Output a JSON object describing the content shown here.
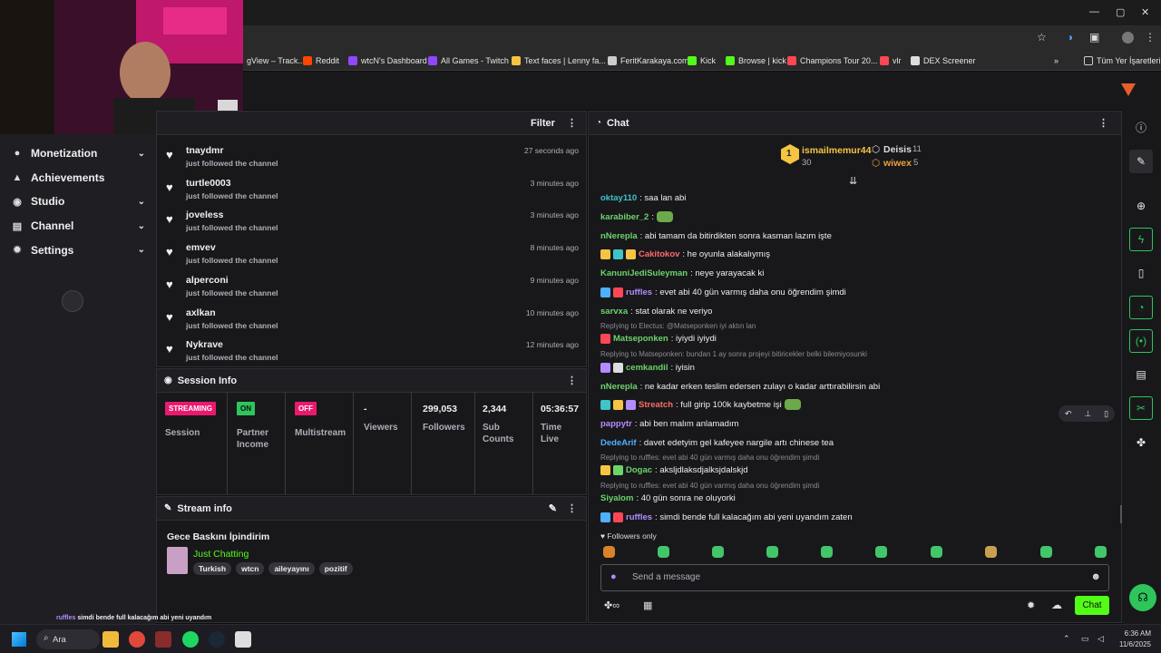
{
  "browser": {
    "bookmarks": [
      {
        "label": "gView – Track...",
        "color": "#3a7bd5"
      },
      {
        "label": "Reddit",
        "color": "#ff4500"
      },
      {
        "label": "wtcN's Dashboard",
        "color": "#9146ff"
      },
      {
        "label": "All Games - Twitch",
        "color": "#9146ff"
      },
      {
        "label": "Text faces | Lenny fa...",
        "color": "#f5c542"
      },
      {
        "label": "FeritKarakaya.com",
        "color": "#cccccc"
      },
      {
        "label": "Kick",
        "color": "#53fc18"
      },
      {
        "label": "Browse | kick",
        "color": "#53fc18"
      },
      {
        "label": "Champions Tour 20...",
        "color": "#ff4655"
      },
      {
        "label": "vlr",
        "color": "#ff4655"
      },
      {
        "label": "DEX Screener",
        "color": "#dddddd"
      }
    ],
    "all_bookmarks_label": "Tüm Yer İşaretleri",
    "chevron": "»"
  },
  "nav": {
    "items": [
      {
        "label": "Monetization",
        "icon": "dollar-icon",
        "glyph": "●",
        "chev": "⌄"
      },
      {
        "label": "Achievements",
        "icon": "trophy-icon",
        "glyph": "▲",
        "chev": ""
      },
      {
        "label": "Studio",
        "icon": "studio-icon",
        "glyph": "◉",
        "chev": "⌄"
      },
      {
        "label": "Channel",
        "icon": "channel-icon",
        "glyph": "▤",
        "chev": "⌄"
      },
      {
        "label": "Settings",
        "icon": "gear-icon",
        "glyph": "✹",
        "chev": "⌄"
      }
    ]
  },
  "activity": {
    "filter_label": "Filter",
    "items": [
      {
        "user": "tnaydmr",
        "action": "just followed the channel",
        "ago": "27 seconds ago"
      },
      {
        "user": "turtle0003",
        "action": "just followed the channel",
        "ago": "3 minutes ago"
      },
      {
        "user": "joveless",
        "action": "just followed the channel",
        "ago": "3 minutes ago"
      },
      {
        "user": "emvev",
        "action": "just followed the channel",
        "ago": "8 minutes ago"
      },
      {
        "user": "alperconi",
        "action": "just followed the channel",
        "ago": "9 minutes ago"
      },
      {
        "user": "axlkan",
        "action": "just followed the channel",
        "ago": "10 minutes ago"
      },
      {
        "user": "Nykrave",
        "action": "just followed the channel",
        "ago": "12 minutes ago"
      }
    ]
  },
  "session": {
    "title": "Session Info",
    "streaming_badge": "STREAMING",
    "session_label": "Session",
    "partner_badge": "ON",
    "partner_label": "Partner Income",
    "multistream_badge": "OFF",
    "multistream_label": "Multistream",
    "viewers_value": "-",
    "viewers_label": "Viewers",
    "followers_value": "299,053",
    "followers_label": "Followers",
    "subs_value": "2,344",
    "subs_label": "Sub Counts",
    "time_value": "05:36:57",
    "time_label": "Time Live"
  },
  "stream_info": {
    "title": "Stream info",
    "stream_title": "Gece Baskını İpindirim",
    "category": "Just Chatting",
    "tags": [
      "Turkish",
      "wtcn",
      "aileyayını",
      "pozitif"
    ]
  },
  "chat": {
    "title": "Chat",
    "leaderboard": [
      {
        "rank": "1",
        "user": "ismailmemur44",
        "count": "30"
      },
      {
        "user": "Deisis",
        "count": "11"
      },
      {
        "user": "wiwex",
        "count": "5"
      }
    ],
    "messages": [
      {
        "user": "oktay110",
        "color": "#3fc4c8",
        "text": ": saa lan abi"
      },
      {
        "user": "karabiber_2",
        "color": "#6bd46b",
        "text": ":"
      },
      {
        "user": "nNerepla",
        "color": "#6bd46b",
        "text": ": abi tamam da bitirdikten sonra kasman lazım işte"
      },
      {
        "user": "Cakitokov",
        "color": "#ff6b6b",
        "text": ": he oyunla alakalıymış"
      },
      {
        "user": "KanuniJediSuleyman",
        "color": "#6bd46b",
        "text": ": neye yarayacak ki"
      },
      {
        "user": "ruffles",
        "color": "#b48cff",
        "text": ": evet abi 40 gün varmış daha onu öğrendim şimdi"
      },
      {
        "user": "sarvxa",
        "color": "#6bd46b",
        "text": ": stat olarak ne veriyo"
      },
      {
        "reply": "Replying to Electus: @Matseponken iyi aktın lan"
      },
      {
        "user": "Matseponken",
        "color": "#6bd46b",
        "text": ": iyiydi iyiydi"
      },
      {
        "reply": "Replying to Matseponken: bundan 1 ay sonra projeyi bitiricekler belki bilemiyosunki"
      },
      {
        "user": "cemkandil",
        "color": "#6bd46b",
        "text": ": iyisin"
      },
      {
        "user": "nNerepla",
        "color": "#6bd46b",
        "text": ": ne kadar erken teslim edersen zulayı o kadar arttırabilirsin abi"
      },
      {
        "user": "Streatch",
        "color": "#ff6b6b",
        "text": ": full girip 100k kaybetme işi"
      },
      {
        "user": "pappytr",
        "color": "#b48cff",
        "text": ": abi ben malım anlamadım"
      },
      {
        "user": "DedeArif",
        "color": "#4fb0ff",
        "text": ": davet edetyim gel kafeyee nargile artı chinese tea"
      },
      {
        "reply": "Replying to ruffles: evet abi 40 gün varmış daha onu öğrendim şimdi"
      },
      {
        "user": "Dogac",
        "color": "#6bd46b",
        "text": ": aksljdlaksdjalksjdalskjd"
      },
      {
        "reply": "Replying to ruffles: evet abi 40 gün varmış daha onu öğrendim şimdi"
      },
      {
        "user": "Siyalom",
        "color": "#6bd46b",
        "text": ": 40 gün sonra ne oluyorki"
      },
      {
        "user": "ruffles",
        "color": "#b48cff",
        "text": ": simdi bende full kalacağım abi yeni uyandım zaten"
      }
    ],
    "followers_only": "Followers only",
    "input_placeholder": "Send a message",
    "send_label": "Chat"
  },
  "overlay_chat": {
    "user": "ruffles",
    "text": "simdi bende full kalacağım abi yeni uyandım zaten"
  },
  "taskbar": {
    "search_label": "Ara",
    "time": "6:36 AM",
    "date": "11/6/2025"
  }
}
